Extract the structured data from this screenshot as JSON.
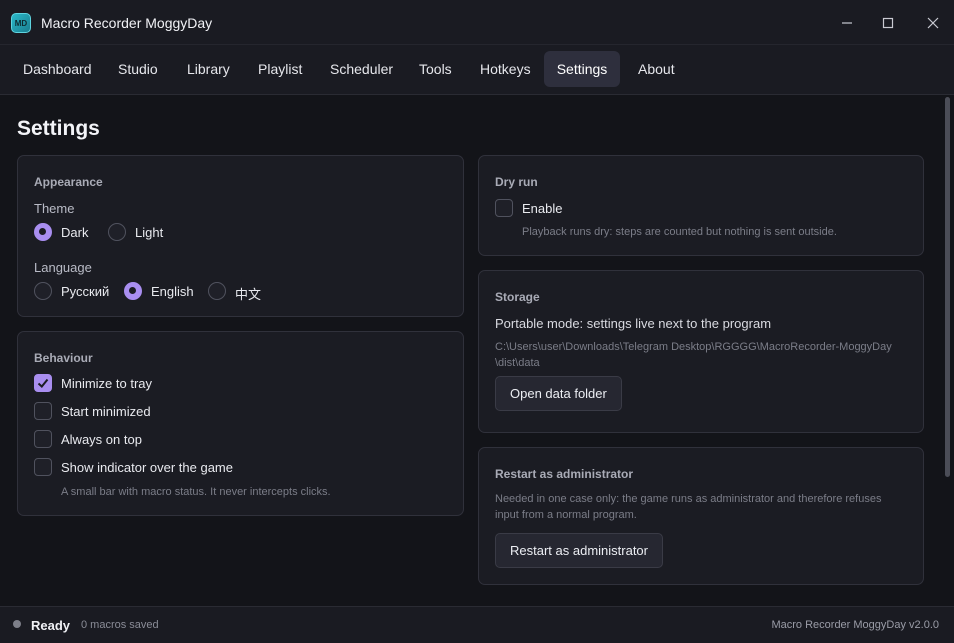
{
  "window": {
    "title": "Macro Recorder MoggyDay",
    "icon_text": "MD"
  },
  "tabs": [
    {
      "label": "Dashboard"
    },
    {
      "label": "Studio"
    },
    {
      "label": "Library"
    },
    {
      "label": "Playlist"
    },
    {
      "label": "Scheduler"
    },
    {
      "label": "Tools"
    },
    {
      "label": "Hotkeys"
    },
    {
      "label": "Settings",
      "active": true
    },
    {
      "label": "About"
    }
  ],
  "page": {
    "title": "Settings"
  },
  "appearance": {
    "title": "Appearance",
    "theme_label": "Theme",
    "theme_options": [
      "Dark",
      "Light"
    ],
    "theme_selected": "Dark",
    "language_label": "Language",
    "language_options": [
      "Русский",
      "English",
      "中文"
    ],
    "language_selected": "English"
  },
  "behaviour": {
    "title": "Behaviour",
    "options": [
      {
        "label": "Minimize to tray",
        "checked": true
      },
      {
        "label": "Start minimized",
        "checked": false
      },
      {
        "label": "Always on top",
        "checked": false
      },
      {
        "label": "Show indicator over the game",
        "checked": false
      }
    ],
    "hint": "A small bar with macro status. It never intercepts clicks."
  },
  "dry_run": {
    "title": "Dry run",
    "enable_label": "Enable",
    "checked": false,
    "hint": "Playback runs dry: steps are counted but nothing is sent outside."
  },
  "storage": {
    "title": "Storage",
    "mode_text": "Portable mode: settings live next to the program",
    "path_line1": "C:\\Users\\user\\Downloads\\Telegram Desktop\\RGGGG\\MacroRecorder-MoggyDay",
    "path_line2": "\\dist\\data",
    "button": "Open data folder"
  },
  "admin": {
    "title": "Restart as administrator",
    "desc_line1": "Needed in one case only: the game runs as administrator and therefore refuses",
    "desc_line2": "input from a normal program.",
    "button": "Restart as administrator"
  },
  "status": {
    "state": "Ready",
    "count": "0 macros saved",
    "version": "Macro Recorder MoggyDay v2.0.0"
  },
  "colors": {
    "accent": "#a98ef0",
    "background": "#131419",
    "card": "#1b1c23"
  }
}
